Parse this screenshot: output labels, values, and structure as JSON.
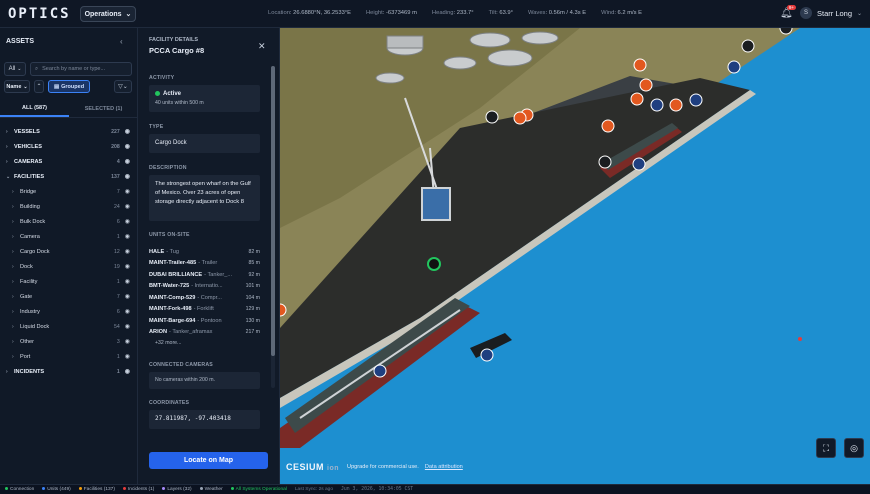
{
  "topbar": {
    "logo": "OPTICS",
    "ops_label": "Operations",
    "stats": [
      {
        "label": "Location",
        "value": "26.6880°N, 36.2533°E"
      },
      {
        "label": "Height",
        "value": "-6373469 m"
      },
      {
        "label": "Heading",
        "value": "233.7°"
      },
      {
        "label": "Tilt",
        "value": "63.9°"
      },
      {
        "label": "Waves",
        "value": "0.56m / 4.3s E"
      },
      {
        "label": "Wind",
        "value": "6.2 m/s E"
      }
    ],
    "notif_count": "9+",
    "user_initial": "S",
    "user_name": "Starr Long"
  },
  "assets": {
    "title": "ASSETS",
    "filter_all": "All",
    "search_placeholder": "Search by name or type...",
    "sort_label": "Name",
    "group_label": "Grouped",
    "tab_all": "ALL (587)",
    "tab_selected": "SELECTED (1)",
    "tree": [
      {
        "label": "VESSELS",
        "count": "227",
        "level": 0,
        "open": false
      },
      {
        "label": "VEHICLES",
        "count": "208",
        "level": 0,
        "open": false
      },
      {
        "label": "CAMERAS",
        "count": "4",
        "level": 0,
        "open": false
      },
      {
        "label": "FACILITIES",
        "count": "137",
        "level": 0,
        "open": true
      },
      {
        "label": "Bridge",
        "count": "7",
        "level": 1
      },
      {
        "label": "Building",
        "count": "24",
        "level": 1
      },
      {
        "label": "Bulk Dock",
        "count": "6",
        "level": 1
      },
      {
        "label": "Camera",
        "count": "1",
        "level": 1
      },
      {
        "label": "Cargo Dock",
        "count": "12",
        "level": 1
      },
      {
        "label": "Dock",
        "count": "19",
        "level": 1
      },
      {
        "label": "Facility",
        "count": "1",
        "level": 1
      },
      {
        "label": "Gate",
        "count": "7",
        "level": 1
      },
      {
        "label": "Industry",
        "count": "6",
        "level": 1
      },
      {
        "label": "Liquid Dock",
        "count": "54",
        "level": 1
      },
      {
        "label": "Other",
        "count": "3",
        "level": 1
      },
      {
        "label": "Port",
        "count": "1",
        "level": 1
      },
      {
        "label": "INCIDENTS",
        "count": "1",
        "level": 0,
        "open": false
      }
    ]
  },
  "details": {
    "header": "FACILITY DETAILS",
    "title": "PCCA Cargo #8",
    "activity_label": "ACTIVITY",
    "status": "Active",
    "status_sub": "40 units within 500 m",
    "type_label": "TYPE",
    "type_value": "Cargo Dock",
    "description_label": "DESCRIPTION",
    "description": "The strongest open wharf on the Gulf of Mexico. Over 23 acres of open storage directly adjacent to Dock 8",
    "units_label": "UNITS ON-SITE",
    "units": [
      {
        "name": "HALE",
        "type": "Tug",
        "dist": "82 m"
      },
      {
        "name": "MAINT-Trailer-485",
        "type": "Trailer",
        "dist": "85 m"
      },
      {
        "name": "DUBAI BRILLIANCE",
        "type": "Tanker_...",
        "dist": "92 m"
      },
      {
        "name": "BMT-Water-725",
        "type": "Internatio...",
        "dist": "101 m"
      },
      {
        "name": "MAINT-Comp-529",
        "type": "Compr...",
        "dist": "104 m"
      },
      {
        "name": "MAINT-Fork-498",
        "type": "Forklift",
        "dist": "129 m"
      },
      {
        "name": "MAINT-Barge-694",
        "type": "Pontoon",
        "dist": "130 m"
      },
      {
        "name": "ARION",
        "type": "Tanker_aframax",
        "dist": "217 m"
      }
    ],
    "units_more": "+32 more...",
    "cameras_label": "CONNECTED CAMERAS",
    "cameras_value": "No cameras within 200 m.",
    "coords_label": "COORDINATES",
    "coords_value": "27.811987, -97.403418",
    "locate_label": "Locate on Map"
  },
  "map": {
    "cesium_brand": "CESIUM",
    "cesium_ion": "ion",
    "upgrade_text": "Upgrade for commercial use.",
    "attribution": "Data attribution",
    "water_color": "#1d8fd0",
    "land_color": "#8a8457",
    "pier_color": "#2c2d2b"
  },
  "status": {
    "connection": "Connection",
    "units": "Units (449)",
    "facilities": "Facilities (137)",
    "incidents": "Incidents (1)",
    "layers": "Layers (32)",
    "weather": "Weather",
    "systems": "All Systems Operational",
    "last_sync": "Last Sync: 2s ago",
    "datetime": "Jun 3, 2026, 10:34:05 CST"
  }
}
